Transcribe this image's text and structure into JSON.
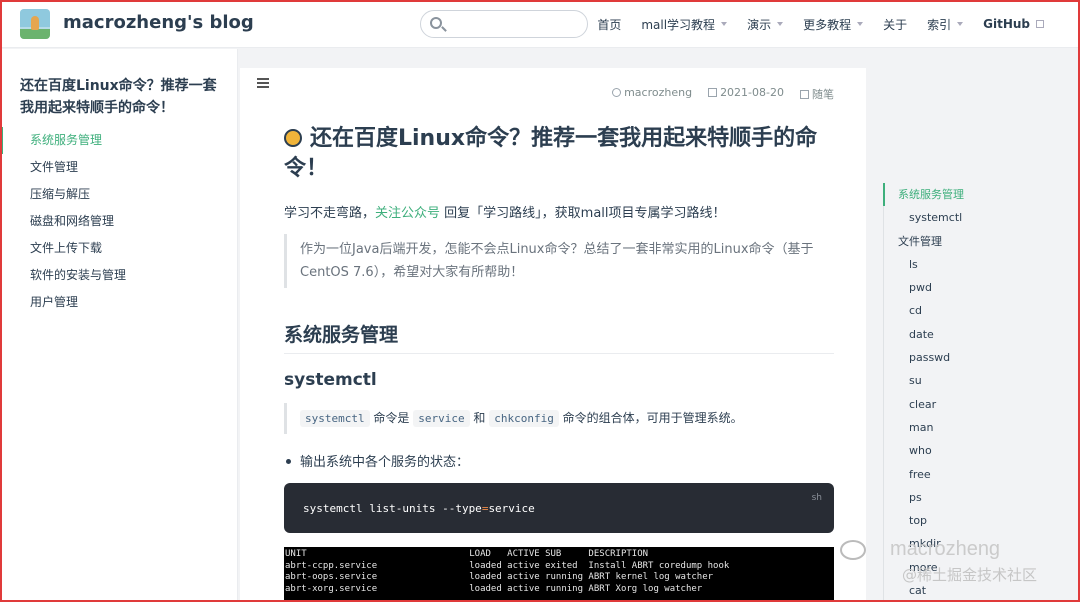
{
  "navbar": {
    "site_name": "macrozheng's blog",
    "search_placeholder": "",
    "links": [
      {
        "label": "首页",
        "dropdown": false,
        "external": false
      },
      {
        "label": "mall学习教程",
        "dropdown": true,
        "external": false
      },
      {
        "label": "演示",
        "dropdown": true,
        "external": false
      },
      {
        "label": "更多教程",
        "dropdown": true,
        "external": false
      },
      {
        "label": "关于",
        "dropdown": false,
        "external": false
      },
      {
        "label": "索引",
        "dropdown": true,
        "external": false
      },
      {
        "label": "GitHub",
        "dropdown": false,
        "external": true
      }
    ]
  },
  "sidebar": {
    "title": "还在百度Linux命令？推荐一套我用起来特顺手的命令！",
    "items": [
      "系统服务管理",
      "文件管理",
      "压缩与解压",
      "磁盘和网络管理",
      "文件上传下载",
      "软件的安装与管理",
      "用户管理"
    ],
    "active_index": 0
  },
  "article": {
    "author": "macrozheng",
    "date": "2021-08-20",
    "category": "随笔",
    "title": "还在百度Linux命令？推荐一套我用起来特顺手的命令！",
    "intro_prefix": "学习不走弯路，",
    "intro_link": "关注公众号",
    "intro_suffix": " 回复「学习路线」，获取mall项目专属学习路线！",
    "quote": "作为一位Java后端开发，怎能不会点Linux命令？总结了一套非常实用的Linux命令（基于CentOS 7.6），希望对大家有所帮助！",
    "h2": "系统服务管理",
    "h3": "systemctl",
    "desc": {
      "code1": "systemctl",
      "text1": " 命令是 ",
      "code2": "service",
      "text2": " 和 ",
      "code3": "chkconfig",
      "text3": " 命令的组合体，可用于管理系统。"
    },
    "bullet": "输出系统中各个服务的状态：",
    "codeblock": {
      "lang": "sh",
      "cmd_before": "systemctl list-units --type",
      "cmd_op": "=",
      "cmd_after": "service"
    },
    "terminal": [
      "UNIT                              LOAD   ACTIVE SUB     DESCRIPTION",
      "abrt-ccpp.service                 loaded active exited  Install ABRT coredump hook",
      "abrt-oops.service                 loaded active running ABRT kernel log watcher",
      "abrt-xorg.service                 loaded active running ABRT Xorg log watcher"
    ]
  },
  "toc": {
    "items": [
      {
        "label": "系统服务管理",
        "level": 1
      },
      {
        "label": "systemctl",
        "level": 2
      },
      {
        "label": "文件管理",
        "level": 1
      },
      {
        "label": "ls",
        "level": 2
      },
      {
        "label": "pwd",
        "level": 2
      },
      {
        "label": "cd",
        "level": 2
      },
      {
        "label": "date",
        "level": 2
      },
      {
        "label": "passwd",
        "level": 2
      },
      {
        "label": "su",
        "level": 2
      },
      {
        "label": "clear",
        "level": 2
      },
      {
        "label": "man",
        "level": 2
      },
      {
        "label": "who",
        "level": 2
      },
      {
        "label": "free",
        "level": 2
      },
      {
        "label": "ps",
        "level": 2
      },
      {
        "label": "top",
        "level": 2
      },
      {
        "label": "mkdir",
        "level": 2
      },
      {
        "label": "more",
        "level": 2
      },
      {
        "label": "cat",
        "level": 2
      }
    ],
    "active_index": 0
  },
  "watermark": {
    "name": "macrozheng",
    "sub": "@稀土掘金技术社区"
  },
  "colors": {
    "accent": "#3eaf7c",
    "frame": "#e03a3a",
    "code_bg": "#282c34"
  }
}
